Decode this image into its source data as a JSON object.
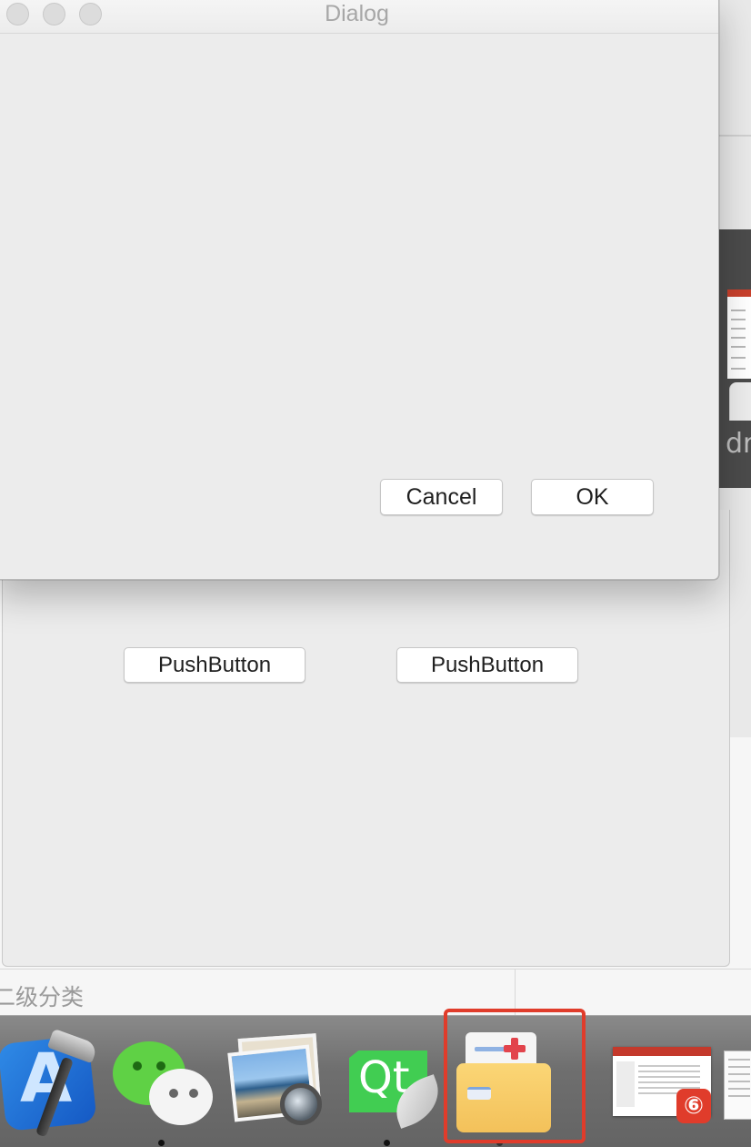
{
  "dialog": {
    "title": "Dialog",
    "cancel_label": "Cancel",
    "ok_label": "OK"
  },
  "main_window": {
    "push_button_1_label": "PushButton",
    "push_button_2_label": "PushButton"
  },
  "background": {
    "category_label": "二级分类",
    "thumbnail_text": "dr"
  },
  "dock": {
    "items": [
      {
        "name": "xcode",
        "icon": "xcode-icon",
        "running": false
      },
      {
        "name": "wechat",
        "icon": "wechat-icon",
        "running": true
      },
      {
        "name": "preview",
        "icon": "preview-icon",
        "running": false
      },
      {
        "name": "qt-creator",
        "icon": "qt-icon",
        "label": "Qt",
        "running": true
      },
      {
        "name": "health-folder",
        "icon": "folder-medical-icon",
        "highlighted": true,
        "running": true
      },
      {
        "name": "netease-music-window",
        "icon": "netease-music-icon",
        "badge": "⑥"
      }
    ]
  },
  "colors": {
    "highlight": "#e03c2b",
    "dialog_bg": "#ececec",
    "dock_bg": "#6f6f6f"
  }
}
